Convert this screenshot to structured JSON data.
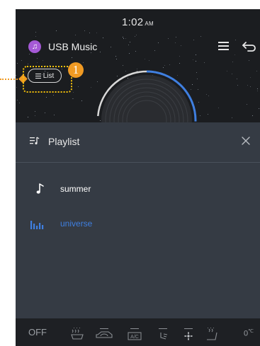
{
  "status_bar": {
    "time": "1:02",
    "ampm": "AM"
  },
  "app_bar": {
    "title": "USB Music",
    "app_icon": "music-note-icon",
    "menu_icon": "hamburger-icon",
    "back_icon": "return-arrow-icon"
  },
  "list_button": {
    "label": "List",
    "icon": "list-icon"
  },
  "callout": {
    "number": "1",
    "color": "#f09a23",
    "highlight_color": "#f6c20a"
  },
  "playlist": {
    "title": "Playlist",
    "songs": [
      {
        "name": "summer",
        "icon": "music-note-icon",
        "playing": false,
        "color": "#ffffff"
      },
      {
        "name": "universe",
        "icon": "equalizer-icon",
        "playing": true,
        "color": "#3f7fe0"
      }
    ]
  },
  "climate_bar": {
    "off_label": "OFF",
    "temp_label": "0",
    "temp_unit": "℃"
  },
  "colors": {
    "accent": "#3f7fe0",
    "panel": "#353b44",
    "background": "#1b1d20"
  }
}
